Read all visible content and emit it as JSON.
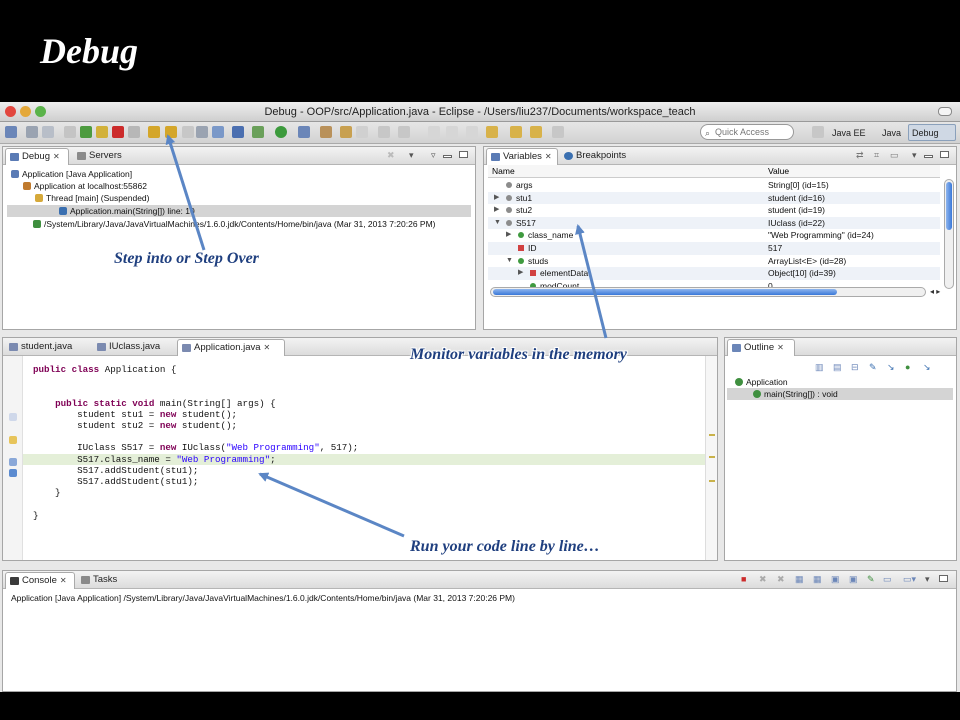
{
  "slide": {
    "title": "Debug"
  },
  "window": {
    "title": "Debug - OOP/src/Application.java - Eclipse - /Users/liu237/Documents/workspace_teach"
  },
  "toolbar": {
    "quick_access_placeholder": "Quick Access",
    "perspectives": [
      "Java EE",
      "Java",
      "Debug"
    ],
    "active_perspective": "Debug"
  },
  "debug_view": {
    "tabs": [
      {
        "label": "Debug"
      },
      {
        "label": "Servers"
      }
    ],
    "tree": [
      {
        "label": "Application [Java Application]"
      },
      {
        "label": "Application at localhost:55862"
      },
      {
        "label": "Thread [main] (Suspended)"
      },
      {
        "label": "Application.main(String[]) line: 10"
      },
      {
        "label": "/System/Library/Java/JavaVirtualMachines/1.6.0.jdk/Contents/Home/bin/java (Mar 31, 2013 7:20:26 PM)"
      }
    ],
    "selected_index": 3
  },
  "variables_view": {
    "tabs": [
      {
        "label": "Variables"
      },
      {
        "label": "Breakpoints"
      }
    ],
    "columns": [
      "Name",
      "Value"
    ],
    "rows": [
      {
        "name": "args",
        "value": "String[0]  (id=15)"
      },
      {
        "name": "stu1",
        "value": "student  (id=16)"
      },
      {
        "name": "stu2",
        "value": "student  (id=19)"
      },
      {
        "name": "S517",
        "value": "IUclass  (id=22)"
      },
      {
        "name": "class_name",
        "value": "\"Web Programming\" (id=24)"
      },
      {
        "name": "ID",
        "value": "517"
      },
      {
        "name": "studs",
        "value": "ArrayList<E>  (id=28)"
      },
      {
        "name": "elementData",
        "value": "Object[10]  (id=39)"
      },
      {
        "name": "modCount",
        "value": "0"
      }
    ]
  },
  "editor": {
    "tabs": [
      {
        "label": "student.java"
      },
      {
        "label": "IUclass.java"
      },
      {
        "label": "Application.java"
      }
    ],
    "active_tab": "Application.java",
    "lines": [
      "public class Application {",
      "",
      "",
      "    public static void main(String[] args) {",
      "        student stu1 = new student();",
      "        student stu2 = new student();",
      "",
      "        IUclass S517 = new IUclass(\"Web Programming\", 517);",
      "        S517.class_name = \"Web Programming\";",
      "        S517.addStudent(stu1);",
      "        S517.addStudent(stu1);",
      "    }",
      "",
      "}"
    ],
    "current_line_index": 8
  },
  "outline_view": {
    "tab": "Outline",
    "tree": [
      {
        "label": "Application"
      },
      {
        "label": "main(String[]) : void"
      }
    ]
  },
  "console_view": {
    "tabs": [
      {
        "label": "Console"
      },
      {
        "label": "Tasks"
      }
    ],
    "text": "Application [Java Application] /System/Library/Java/JavaVirtualMachines/1.6.0.jdk/Contents/Home/bin/java (Mar 31, 2013 7:20:26 PM)"
  },
  "annotations": {
    "step": "Step into or Step Over",
    "monitor": "Monitor variables in the memory",
    "run": "Run your code line by line…"
  },
  "colors": {
    "annotation_text": "#1f3f7f",
    "arrow": "#5b86c5",
    "current_line": "#e4efd8"
  }
}
